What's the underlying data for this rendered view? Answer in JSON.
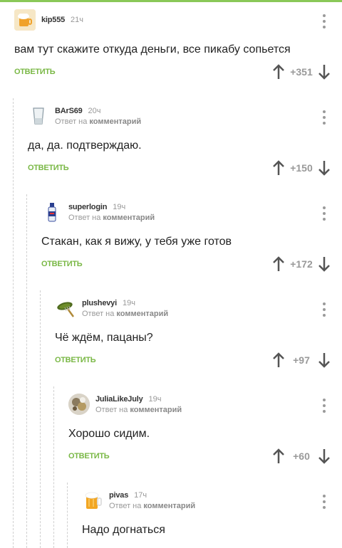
{
  "comments": [
    {
      "user": "kip555",
      "time": "21ч",
      "reply_prefix": "",
      "reply_target": "",
      "text": "вам тут скажите откуда деньги, все пикабу сопьется",
      "reply_label": "ОТВЕТИТЬ",
      "rating": "+351",
      "avatar": "beer-mug-avatar"
    },
    {
      "user": "BArS69",
      "time": "20ч",
      "reply_prefix": "Ответ на ",
      "reply_target": "комментарий",
      "text": "да, да. подтверждаю.",
      "reply_label": "ОТВЕТИТЬ",
      "rating": "+150",
      "avatar": "glass-avatar"
    },
    {
      "user": "superlogin",
      "time": "19ч",
      "reply_prefix": "Ответ на ",
      "reply_target": "комментарий",
      "text": "Стакан, как я вижу, у тебя уже готов",
      "reply_label": "ОТВЕТИТЬ",
      "rating": "+172",
      "avatar": "bottle-avatar"
    },
    {
      "user": "plushevyi",
      "time": "19ч",
      "reply_prefix": "Ответ на ",
      "reply_target": "комментарий",
      "text": "Чё ждём, пацаны?",
      "reply_label": "ОТВЕТИТЬ",
      "rating": "+97",
      "avatar": "pickle-fork-avatar"
    },
    {
      "user": "JuliaLikeJuly",
      "time": "19ч",
      "reply_prefix": "Ответ на ",
      "reply_target": "комментарий",
      "text": "Хорошо сидим.",
      "reply_label": "ОТВЕТИТЬ",
      "rating": "+60",
      "avatar": "photo-avatar"
    },
    {
      "user": "pivas",
      "time": "17ч",
      "reply_prefix": "Ответ на ",
      "reply_target": "комментарий",
      "text": "Надо догнаться",
      "reply_label": "",
      "rating": "",
      "avatar": "beer-glass-avatar"
    }
  ],
  "colors": {
    "accent": "#7ab846",
    "topbar": "#8ac858",
    "muted": "#999999"
  }
}
